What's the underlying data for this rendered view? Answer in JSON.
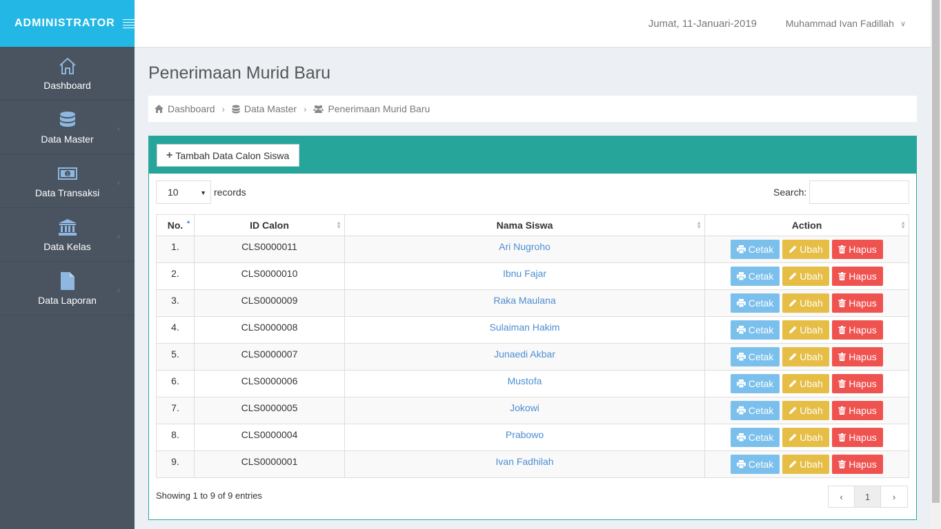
{
  "brand": {
    "title": "ADMINISTRATOR"
  },
  "sidebar": {
    "items": [
      {
        "label": "Dashboard",
        "icon": "home-icon"
      },
      {
        "label": "Data Master",
        "icon": "database-icon"
      },
      {
        "label": "Data Transaksi",
        "icon": "money-icon"
      },
      {
        "label": "Data Kelas",
        "icon": "institution-icon"
      },
      {
        "label": "Data Laporan",
        "icon": "file-icon"
      }
    ]
  },
  "header": {
    "date": "Jumat, 11-Januari-2019",
    "user": "Muhammad Ivan Fadillah"
  },
  "page": {
    "title": "Penerimaan Murid Baru"
  },
  "breadcrumb": {
    "items": [
      {
        "label": "Dashboard",
        "icon": "home-icon"
      },
      {
        "label": "Data Master",
        "icon": "database-icon"
      },
      {
        "label": "Penerimaan Murid Baru",
        "icon": "users-icon"
      }
    ]
  },
  "toolbar": {
    "add_label": "Tambah Data Calon Siswa"
  },
  "table_controls": {
    "length_value": "10",
    "records_label": "records",
    "search_label": "Search:",
    "search_value": ""
  },
  "table": {
    "columns": [
      "No.",
      "ID Calon",
      "Nama Siswa",
      "Action"
    ],
    "rows": [
      {
        "no": "1.",
        "id": "CLS0000011",
        "name": "Ari Nugroho"
      },
      {
        "no": "2.",
        "id": "CLS0000010",
        "name": "Ibnu Fajar"
      },
      {
        "no": "3.",
        "id": "CLS0000009",
        "name": "Raka Maulana"
      },
      {
        "no": "4.",
        "id": "CLS0000008",
        "name": "Sulaiman Hakim"
      },
      {
        "no": "5.",
        "id": "CLS0000007",
        "name": "Junaedi Akbar"
      },
      {
        "no": "6.",
        "id": "CLS0000006",
        "name": "Mustofa"
      },
      {
        "no": "7.",
        "id": "CLS0000005",
        "name": "Jokowi"
      },
      {
        "no": "8.",
        "id": "CLS0000004",
        "name": "Prabowo"
      },
      {
        "no": "9.",
        "id": "CLS0000001",
        "name": "Ivan Fadhilah"
      }
    ],
    "actions": {
      "print": "Cetak",
      "edit": "Ubah",
      "delete": "Hapus"
    }
  },
  "footer": {
    "info": "Showing 1 to 9 of 9 entries",
    "current_page": "1"
  },
  "colors": {
    "brand": "#23b7e5",
    "sidebar": "#4a5461",
    "panel_header": "#26a69a",
    "cetak": "#7bc0ec",
    "ubah": "#e6bd45",
    "hapus": "#ef5350"
  }
}
